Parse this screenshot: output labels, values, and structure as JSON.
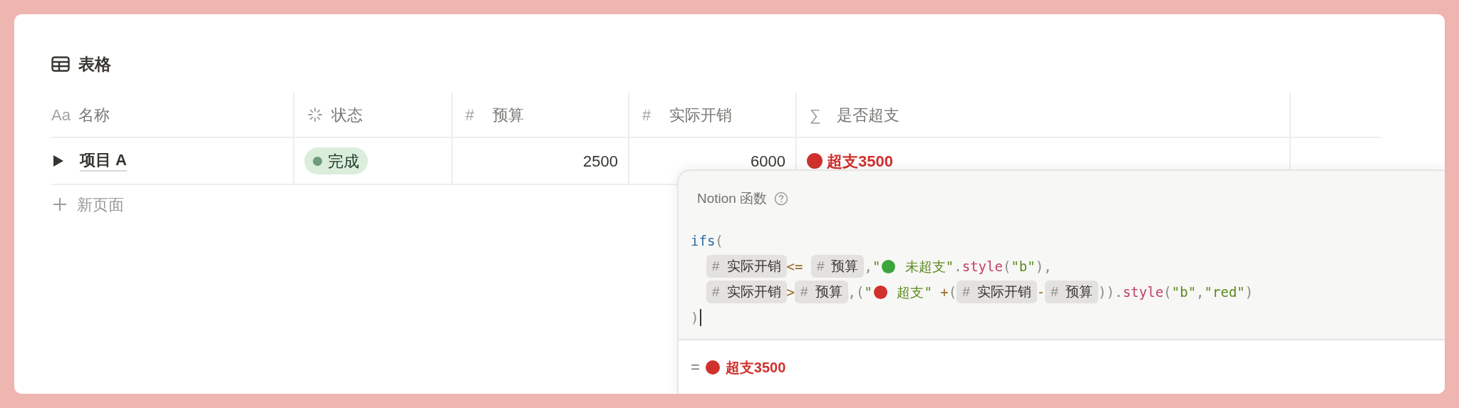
{
  "title": "表格",
  "columns": [
    {
      "kind": "title",
      "label": "名称",
      "icon_text": "Aa"
    },
    {
      "kind": "status",
      "label": "状态"
    },
    {
      "kind": "number",
      "label": "预算",
      "icon_text": "#"
    },
    {
      "kind": "number",
      "label": "实际开销",
      "icon_text": "#"
    },
    {
      "kind": "formula",
      "label": "是否超支",
      "icon_text": "∑"
    },
    {
      "kind": "empty"
    }
  ],
  "rows": [
    {
      "name": "项目 A",
      "expanded": false,
      "status": {
        "label": "完成",
        "color": "#6c9b7d"
      },
      "budget": "2500",
      "actual": "6000",
      "result": {
        "color": "#d0312d",
        "text": "超支3500"
      }
    }
  ],
  "new_page": "新页面",
  "formula_popup": {
    "title": "Notion 函数",
    "code": [
      [
        {
          "kind": "func",
          "text": "ifs"
        },
        {
          "kind": "punct",
          "text": "("
        }
      ],
      [
        {
          "kind": "indent"
        },
        {
          "kind": "chip",
          "icon_text": "#",
          "text": "实际开销"
        },
        {
          "kind": "op",
          "text": "<= "
        },
        {
          "kind": "chip",
          "icon_text": "#",
          "text": "预算"
        },
        {
          "kind": "punct",
          "text": ","
        },
        {
          "kind": "string",
          "text": "\""
        },
        {
          "kind": "dot",
          "color": "#3aa53a"
        },
        {
          "kind": "string",
          "text": " 未超支\""
        },
        {
          "kind": "punct",
          "text": "."
        },
        {
          "kind": "method",
          "text": "style"
        },
        {
          "kind": "punct",
          "text": "("
        },
        {
          "kind": "string",
          "text": "\"b\""
        },
        {
          "kind": "punct",
          "text": "),"
        }
      ],
      [
        {
          "kind": "indent"
        },
        {
          "kind": "chip",
          "icon_text": "#",
          "text": "实际开销"
        },
        {
          "kind": "op",
          "text": ">"
        },
        {
          "kind": "chip",
          "icon_text": "#",
          "text": "预算"
        },
        {
          "kind": "punct",
          "text": ",("
        },
        {
          "kind": "string",
          "text": "\""
        },
        {
          "kind": "dot",
          "color": "#d0312d"
        },
        {
          "kind": "string",
          "text": " 超支\" "
        },
        {
          "kind": "op",
          "text": "+"
        },
        {
          "kind": "punct",
          "text": "("
        },
        {
          "kind": "chip",
          "icon_text": "#",
          "text": "实际开销"
        },
        {
          "kind": "op",
          "text": "-"
        },
        {
          "kind": "chip",
          "icon_text": "#",
          "text": "预算"
        },
        {
          "kind": "punct",
          "text": "))."
        },
        {
          "kind": "method",
          "text": "style"
        },
        {
          "kind": "punct",
          "text": "("
        },
        {
          "kind": "string",
          "text": "\"b\""
        },
        {
          "kind": "punct",
          "text": ","
        },
        {
          "kind": "string",
          "text": "\"red\""
        },
        {
          "kind": "punct",
          "text": ")"
        }
      ],
      [
        {
          "kind": "punct",
          "text": ")"
        },
        {
          "kind": "cursor"
        }
      ]
    ],
    "result_prefix": "=",
    "result": {
      "color": "#d0312d",
      "text": "超支3500"
    }
  }
}
